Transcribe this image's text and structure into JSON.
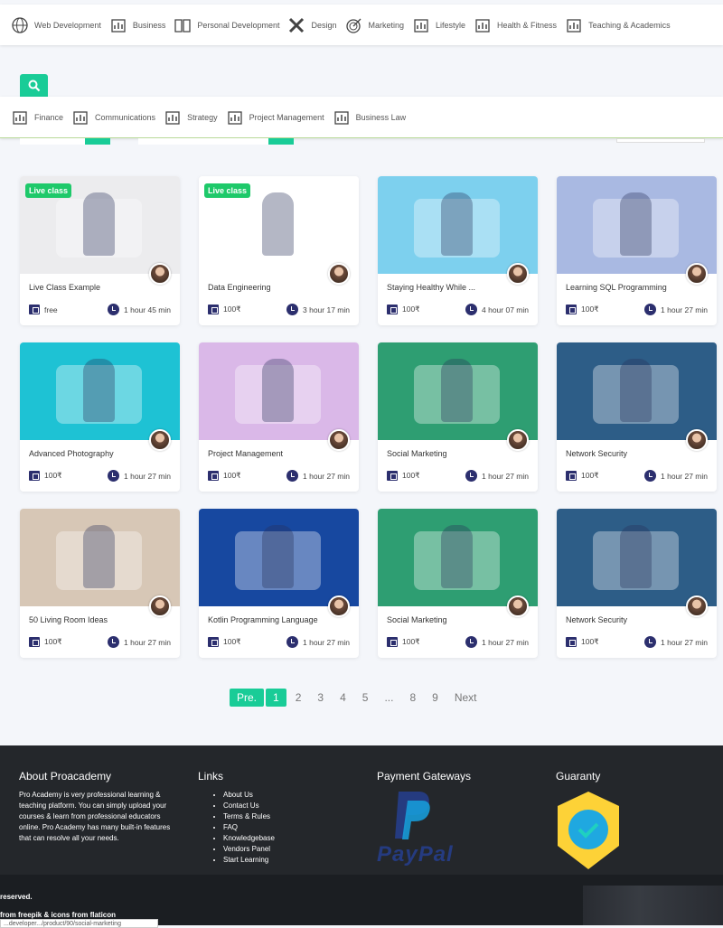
{
  "top_categories": [
    {
      "label": "Web Development",
      "icon": "globe-icon"
    },
    {
      "label": "Business",
      "icon": "chart-icon"
    },
    {
      "label": "Personal Development",
      "icon": "book-icon"
    },
    {
      "label": "Design",
      "icon": "pencil-ruler-icon"
    },
    {
      "label": "Marketing",
      "icon": "target-icon"
    },
    {
      "label": "Lifestyle",
      "icon": "lifestyle-icon"
    },
    {
      "label": "Health & Fitness",
      "icon": "stethoscope-icon"
    },
    {
      "label": "Teaching & Academics",
      "icon": "certificate-icon"
    }
  ],
  "sub_categories": [
    {
      "label": "Finance",
      "icon": "finance-chart-icon"
    },
    {
      "label": "Communications",
      "icon": "people-icon"
    },
    {
      "label": "Strategy",
      "icon": "lightbulb-icon"
    },
    {
      "label": "Project Management",
      "icon": "building-icon"
    },
    {
      "label": "Business Law",
      "icon": "scales-icon"
    }
  ],
  "accent": "#19cc97",
  "courses": [
    {
      "title": "Live Class Example",
      "price": "free",
      "duration": "1 hour 45 min",
      "badge": "Live class",
      "bg": "#ececee"
    },
    {
      "title": "Data Engineering",
      "price": "100₹",
      "duration": "3 hour 17 min",
      "badge": "Live class",
      "bg": "#ffffff"
    },
    {
      "title": "Staying Healthy While ...",
      "price": "100₹",
      "duration": "4 hour 07 min",
      "bg": "#7dd0ee"
    },
    {
      "title": "Learning SQL Programming",
      "price": "100₹",
      "duration": "1 hour 27 min",
      "bg": "#a9b9e2"
    },
    {
      "title": "Advanced Photography",
      "price": "100₹",
      "duration": "1 hour 27 min",
      "bg": "#1ec2d4"
    },
    {
      "title": "Project Management",
      "price": "100₹",
      "duration": "1 hour 27 min",
      "bg": "#dab8e8"
    },
    {
      "title": "Social Marketing",
      "price": "100₹",
      "duration": "1 hour 27 min",
      "bg": "#2e9e72"
    },
    {
      "title": "Network Security",
      "price": "100₹",
      "duration": "1 hour 27 min",
      "bg": "#2d5d87"
    },
    {
      "title": "50 Living Room Ideas",
      "price": "100₹",
      "duration": "1 hour 27 min",
      "bg": "#d7c7b6"
    },
    {
      "title": "Kotlin Programming Language",
      "price": "100₹",
      "duration": "1 hour 27 min",
      "bg": "#1748a0"
    },
    {
      "title": "Social Marketing",
      "price": "100₹",
      "duration": "1 hour 27 min",
      "bg": "#2e9e72"
    },
    {
      "title": "Network Security",
      "price": "100₹",
      "duration": "1 hour 27 min",
      "bg": "#2d5d87"
    }
  ],
  "pagination": {
    "prev": "Pre.",
    "pages": [
      "1",
      "2",
      "3",
      "4",
      "5",
      "...",
      "8",
      "9"
    ],
    "current": "1",
    "next": "Next"
  },
  "footer": {
    "about_title": "About Proacademy",
    "about_text": "Pro Academy is very professional learning & teaching platform. You can simply upload your courses & learn from professional educators online. Pro Academy has many built-in features that can resolve all your needs.",
    "links_title": "Links",
    "links": [
      "About Us",
      "Contact Us",
      "Terms & Rules",
      "FAQ",
      "Knowledgebase",
      "Vendors Panel",
      "Start Learning"
    ],
    "payment_title": "Payment Gateways",
    "paypal": "PayPal",
    "guaranty_title": "Guaranty"
  },
  "bottom": {
    "rights": "reserved.",
    "credits": "from freepik & icons from flaticon",
    "url_tooltip": "...developer.../product/90/social-marketing"
  }
}
